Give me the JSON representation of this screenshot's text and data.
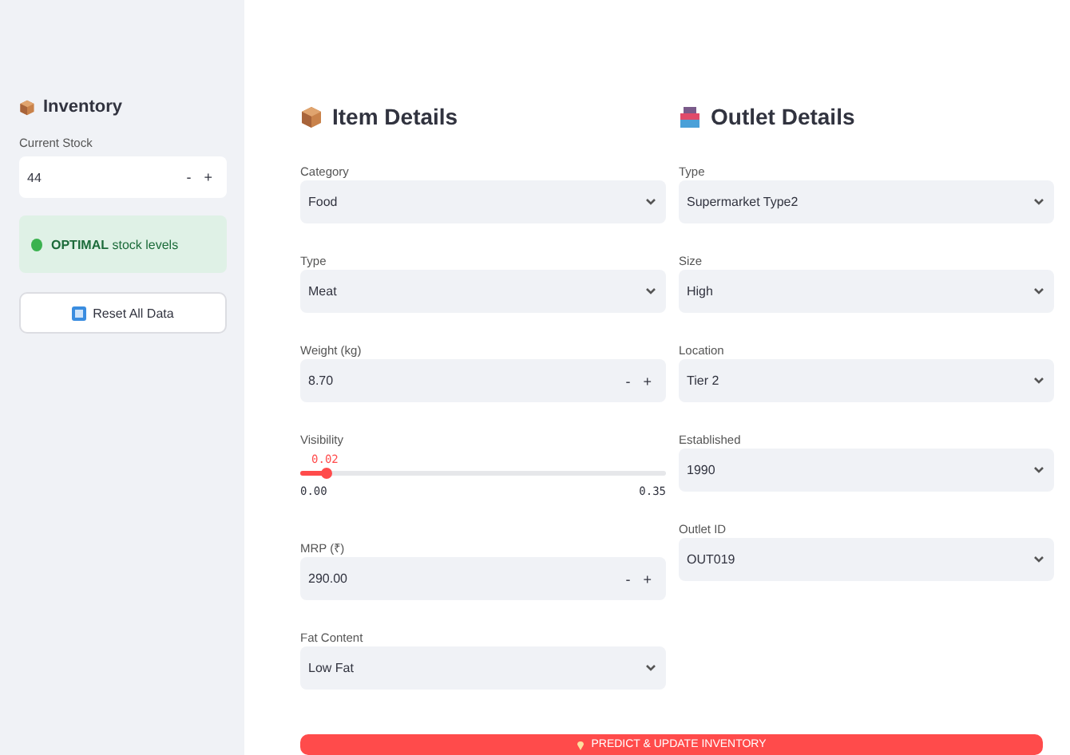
{
  "sidebar": {
    "title": "Inventory",
    "stock": {
      "label": "Current Stock",
      "value": "44",
      "minus": "-",
      "plus": "+"
    },
    "status": {
      "strong": "OPTIMAL",
      "text": "stock levels"
    },
    "reset_button": "Reset All Data"
  },
  "item_details": {
    "title": "Item Details",
    "fields": [
      {
        "kind": "select",
        "label": "Category",
        "value": "Food"
      },
      {
        "kind": "select",
        "label": "Type",
        "value": "Meat"
      },
      {
        "kind": "number",
        "label": "Weight (kg)",
        "value": "8.70",
        "minus": "-",
        "plus": "+"
      },
      {
        "kind": "slider",
        "label": "Visibility",
        "value": "0.02",
        "level": 0.07,
        "min": "0.00",
        "max": "0.35"
      },
      {
        "kind": "number",
        "label": "MRP (₹)",
        "value": "290.00",
        "minus": "-",
        "plus": "+"
      },
      {
        "kind": "select",
        "label": "Fat Content",
        "value": "Low Fat"
      }
    ]
  },
  "outlet_details": {
    "title": "Outlet Details",
    "fields": [
      {
        "kind": "select",
        "label": "Type",
        "value": "Supermarket Type2"
      },
      {
        "kind": "select",
        "label": "Size",
        "value": "High"
      },
      {
        "kind": "select",
        "label": "Location",
        "value": "Tier 2"
      },
      {
        "kind": "select",
        "label": "Established",
        "value": "1990"
      },
      {
        "kind": "select",
        "label": "Outlet ID",
        "value": "OUT019"
      }
    ]
  },
  "predict_button": "PREDICT & UPDATE INVENTORY"
}
